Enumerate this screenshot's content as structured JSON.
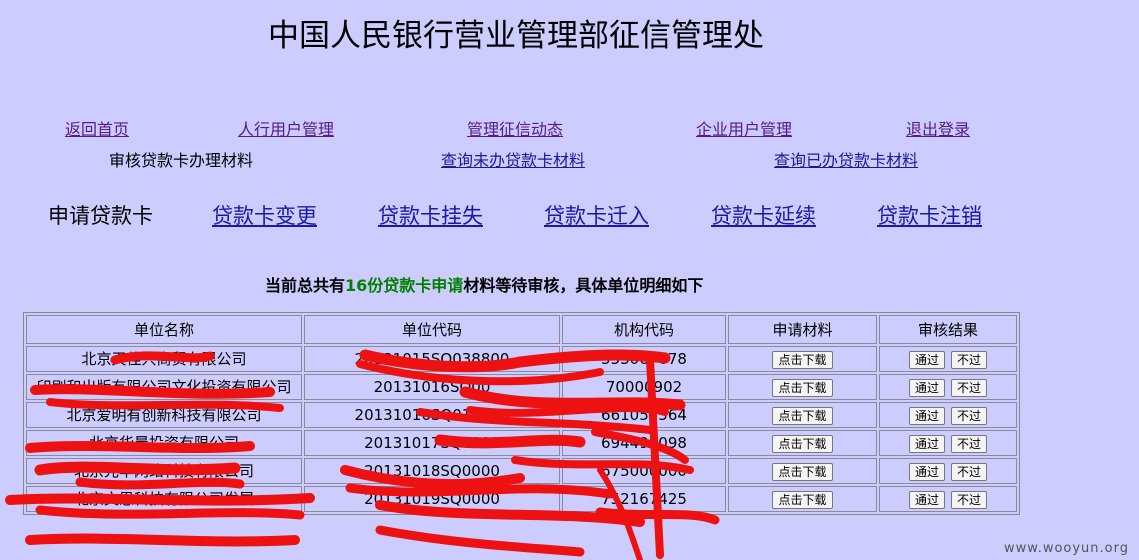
{
  "header": {
    "title": "中国人民银行营业管理部征信管理处"
  },
  "nav": {
    "home": "返回首页",
    "bank_users": "人行用户管理",
    "credit_news": "管理征信动态",
    "company_users": "企业用户管理",
    "logout": "退出登录",
    "review_materials": "审核贷款卡办理材料",
    "query_pending": "查询未办贷款卡材料",
    "query_done": "查询已办贷款卡材料"
  },
  "card_nav": {
    "apply": "申请贷款卡",
    "change": "贷款卡变更",
    "lost": "贷款卡挂失",
    "move_in": "贷款卡迁入",
    "renew": "贷款卡延续",
    "cancel": "贷款卡注销"
  },
  "summary": {
    "prefix": "当前总共有",
    "count": "16份",
    "middle": "贷款卡申请",
    "suffix": "材料等待审核，具体单位明细如下"
  },
  "table": {
    "headers": [
      "单位名称",
      "单位代码",
      "机构代码",
      "申请材料",
      "审核结果"
    ],
    "download_label": "点击下载",
    "approve_label": "通过",
    "reject_label": "不过",
    "rows": [
      {
        "name": "北京天佳兴商贸有限公司",
        "code": "20131015SQ038800",
        "org": "553067678"
      },
      {
        "name": "印刷和出版有限公司文化投资有限公司",
        "code": "20131016SQ00",
        "org": "70000902"
      },
      {
        "name": "北京爱明有创新科技有限公司",
        "code": "20131016SQ015208",
        "org": "661055564"
      },
      {
        "name": "北京华晨投资有限公司",
        "code": "20131017SQ0000",
        "org": "694499098"
      },
      {
        "name": "北京光华网络科技有限公司",
        "code": "20131018SQ0000",
        "org": "675000000"
      },
      {
        "name": "北京文思科技有限公司发展",
        "code": "20131019SQ0000",
        "org": "752167425"
      }
    ]
  },
  "watermark": "www.wooyun.org"
}
